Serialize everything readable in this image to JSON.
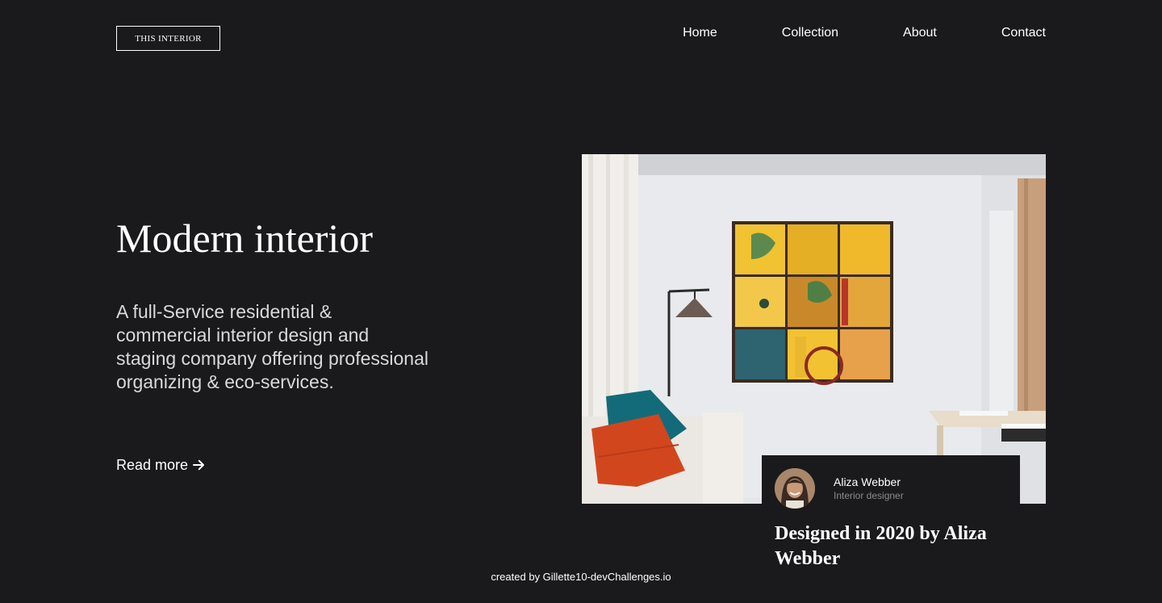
{
  "header": {
    "logo_text": "THIS INTERIOR",
    "nav": [
      {
        "label": "Home"
      },
      {
        "label": "Collection"
      },
      {
        "label": "About"
      },
      {
        "label": "Contact"
      }
    ]
  },
  "hero": {
    "title": "Modern interior",
    "description": "A full-Service residential & commercial interior design and staging company offering professional organizing & eco-services.",
    "read_more_label": "Read more",
    "read_more_icon": "arrow-right-icon"
  },
  "feature_image": {
    "subject": "living room with yellow door-panel artwork, floor lamp, sofa with teal and orange cushions"
  },
  "designer_card": {
    "name": "Aliza Webber",
    "role": "Interior designer",
    "caption": "Designed in 2020 by Aliza Webber"
  },
  "footer": {
    "credit": "created by Gillette10-devChallenges.io"
  },
  "colors": {
    "background": "#1a191b",
    "text": "#ffffff",
    "muted": "#8c8c8c"
  }
}
